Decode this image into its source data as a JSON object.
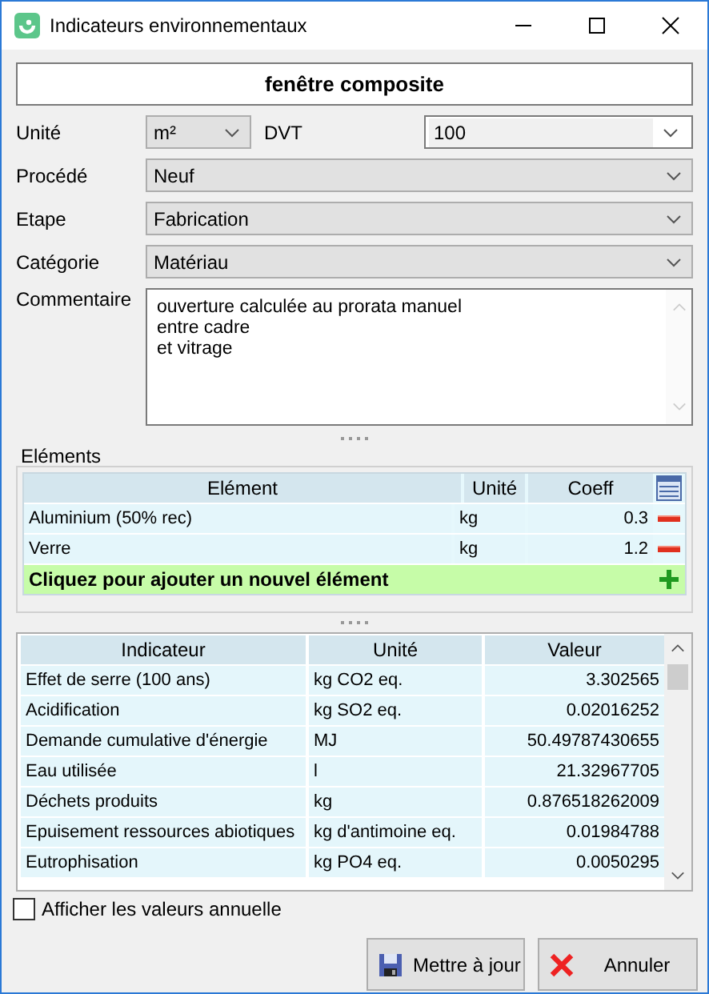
{
  "window": {
    "title": "Indicateurs environnementaux"
  },
  "name": "fenêtre composite",
  "unit": {
    "label": "Unité",
    "value": "m²"
  },
  "dvt": {
    "label": "DVT",
    "value": "100"
  },
  "fields": [
    {
      "label": "Procédé",
      "value": "Neuf"
    },
    {
      "label": "Etape",
      "value": "Fabrication"
    },
    {
      "label": "Catégorie",
      "value": "Matériau"
    }
  ],
  "comment": {
    "label": "Commentaire",
    "value": "ouverture calculée au prorata manuel\nentre cadre\net vitrage"
  },
  "elements": {
    "title": "Eléments",
    "columns": [
      "Elément",
      "Unité",
      "Coeff"
    ],
    "rows": [
      [
        "Aluminium (50% rec)",
        "kg",
        "0.3"
      ],
      [
        "Verre",
        "kg",
        "1.2"
      ]
    ],
    "add_row": "Cliquez pour ajouter un nouvel élément"
  },
  "indicators": {
    "columns": [
      "Indicateur",
      "Unité",
      "Valeur"
    ],
    "rows": [
      [
        "Effet de serre (100 ans)",
        "kg CO2 eq.",
        "3.302565"
      ],
      [
        "Acidification",
        "kg SO2 eq.",
        "0.02016252"
      ],
      [
        "Demande cumulative d'énergie",
        "MJ",
        "50.49787430655"
      ],
      [
        "Eau utilisée",
        "l",
        "21.32967705"
      ],
      [
        "Déchets produits",
        "kg",
        "0.876518262009"
      ],
      [
        "Epuisement ressources abiotiques",
        "kg d'antimoine eq.",
        "0.01984788"
      ],
      [
        "Eutrophisation",
        "kg PO4 eq.",
        "0.0050295"
      ]
    ]
  },
  "annual": {
    "label": "Afficher les valeurs annuelle",
    "checked": false
  },
  "buttons": [
    {
      "kind": "save",
      "label": "Mettre à jour"
    },
    {
      "kind": "cancel",
      "label": "Annuler"
    }
  ]
}
